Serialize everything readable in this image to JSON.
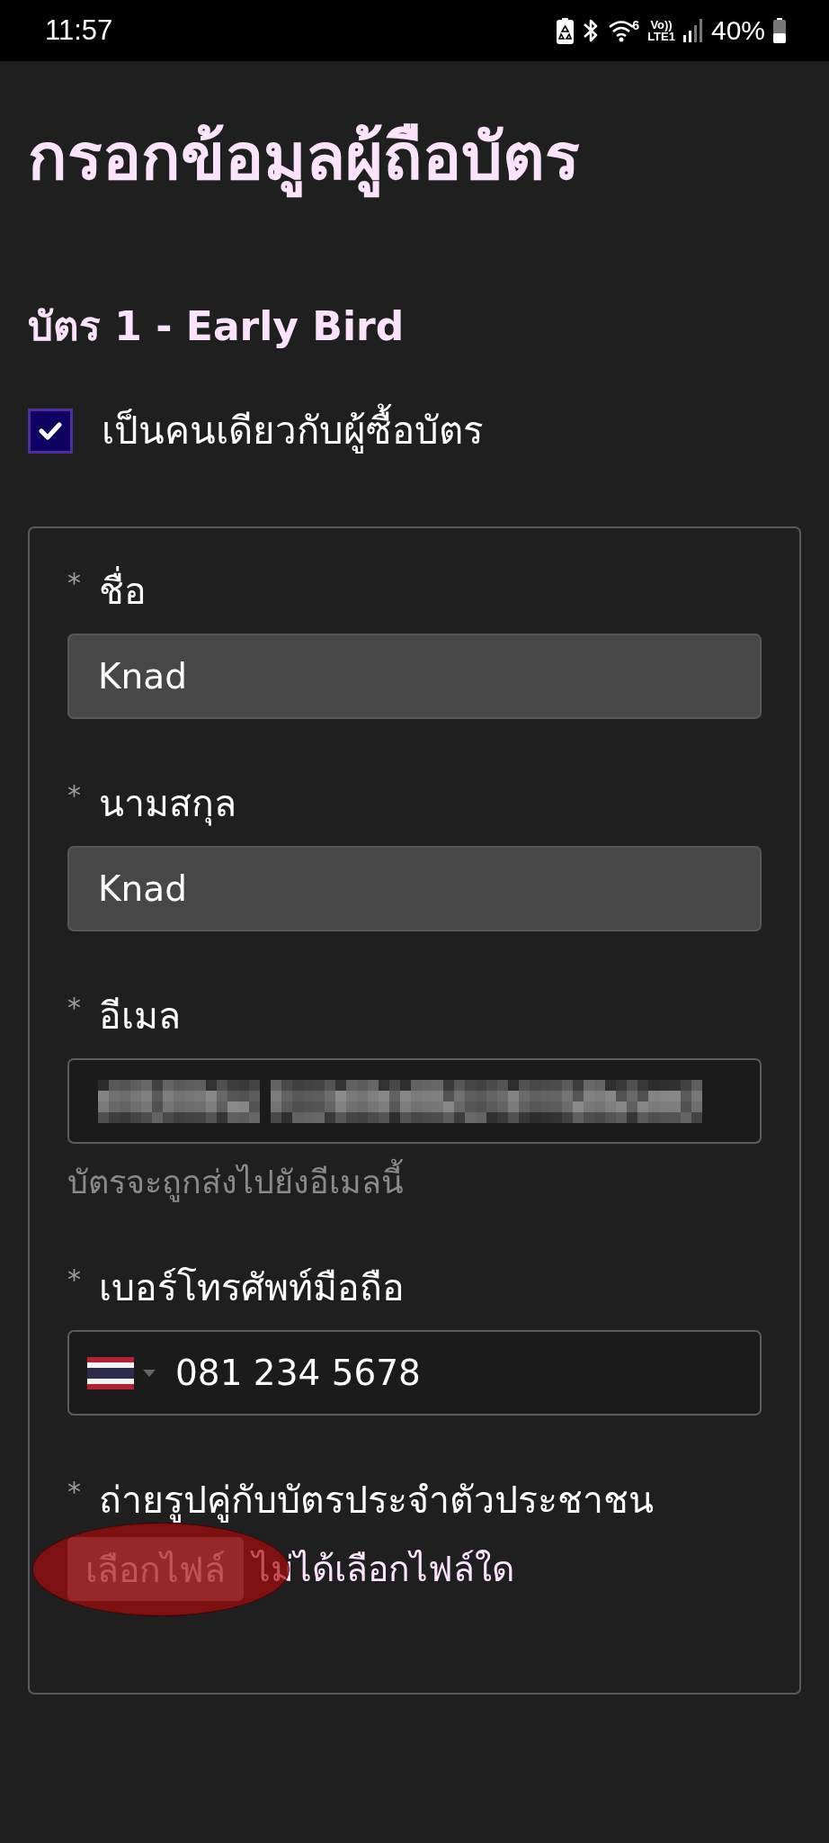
{
  "status_bar": {
    "time": "11:57",
    "wifi_badge": "6",
    "volte_top": "Vo))",
    "volte_bottom": "LTE1",
    "battery_text": "40%"
  },
  "page_title": "กรอกข้อมูลผู้ถือบัตร",
  "ticket_heading": "บัตร 1 - Early Bird",
  "same_as_buyer": {
    "label": "เป็นคนเดียวกับผู้ซื้อบัตร",
    "checked": true
  },
  "form": {
    "fields": [
      {
        "kind": "text",
        "required_mark": "*",
        "label": "ชื่อ",
        "value": "Knad",
        "disabled": true
      },
      {
        "kind": "text",
        "required_mark": "*",
        "label": "นามสกุล",
        "value": "Knad",
        "disabled": true
      },
      {
        "kind": "email",
        "required_mark": "*",
        "label": "อีเมล",
        "redacted": true,
        "hint": "บัตรจะถูกส่งไปยังอีเมลนี้",
        "disabled": false
      },
      {
        "kind": "phone",
        "required_mark": "*",
        "label": "เบอร์โทรศัพท์มือถือ",
        "value": "081 234 5678",
        "disabled": false
      },
      {
        "kind": "file",
        "required_mark": "*",
        "label": "ถ่ายรูปคู่กับบัตรประจำตัวประชาชน",
        "button": "เลือกไฟล์",
        "status": "ไม่ได้เลือกไฟล์ใด",
        "highlighted": true
      }
    ]
  }
}
